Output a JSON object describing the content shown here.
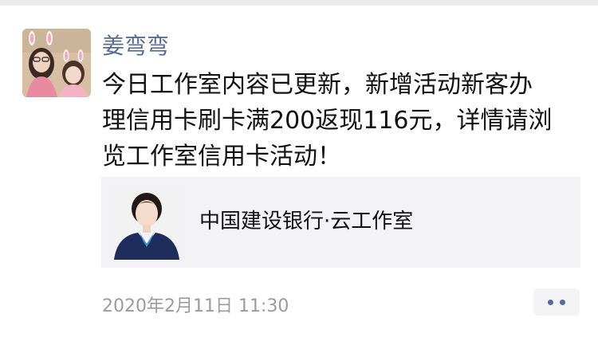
{
  "post": {
    "author_name": "姜弯弯",
    "text": "今日工作室内容已更新，新增活动新客办\n理信用卡刷卡满200返现116元，详情请浏\n览工作室信用卡活动！",
    "timestamp": "2020年2月11日 11:30"
  },
  "link_card": {
    "title": "中国建设银行·云工作室"
  },
  "colors": {
    "author_name": "#576b95",
    "timestamp": "#9b9b9b",
    "card_background": "#f3f3f5",
    "more_dots": "#576b95"
  },
  "icons": {
    "more_button": "more-dots-icon"
  }
}
